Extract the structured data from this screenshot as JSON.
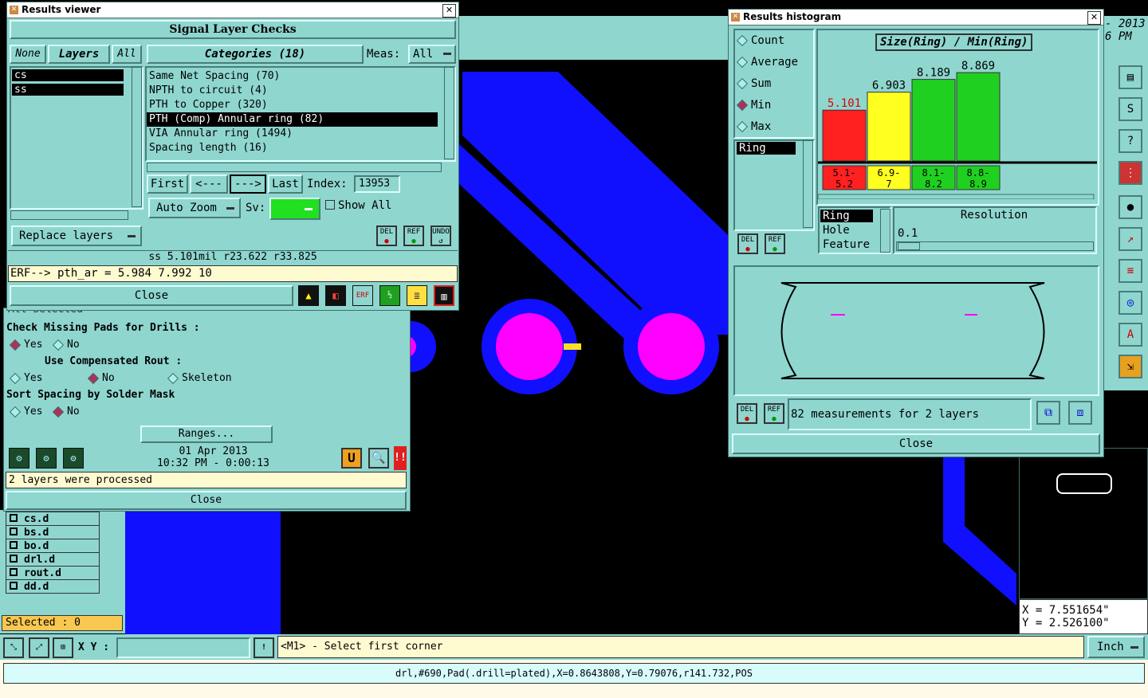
{
  "results_viewer": {
    "title": "Results viewer",
    "header": "Signal Layer Checks",
    "none_btn": "None",
    "layers_btn": "Layers",
    "all_btn": "All",
    "categories_label": "Categories (18)",
    "meas_label": "Meas:",
    "meas_value": "All",
    "layers": [
      "cs",
      "ss"
    ],
    "categories": [
      "Same Net Spacing (70)",
      "NPTH to circuit (4)",
      "PTH to Copper (320)",
      "PTH (Comp) Annular ring (82)",
      "VIA Annular ring (1494)",
      "Spacing length (16)"
    ],
    "nav": {
      "first": "First",
      "prev": "<---",
      "next": "--->",
      "last": "Last",
      "index_label": "Index:",
      "index_value": "13953"
    },
    "auto_zoom": "Auto Zoom",
    "sv_label": "Sv:",
    "show_all": "Show All",
    "replace_layers": "Replace layers",
    "del": "DEL",
    "ref": "REF",
    "undo": "UNDO",
    "status": "ss 5.101mil  r23.622  r33.825",
    "erf_line": "ERF--> pth_ar = 5.984 7.992 10",
    "close": "Close"
  },
  "check_panel": {
    "partial_top": "All        Selected",
    "missing_pads": "Check Missing Pads for Drills :",
    "yes": "Yes",
    "no": "No",
    "comp_rout": "Use Compensated Rout :",
    "skeleton": "Skeleton",
    "sort_spacing": "Sort Spacing by Solder Mask",
    "ranges": "Ranges...",
    "date": "01 Apr 2013",
    "time": "10:32 PM - 0:00:13",
    "processed": "2 layers were processed",
    "close": "Close"
  },
  "layer_list": {
    "items": [
      "cs.d",
      "bs.d",
      "bo.d",
      "drl.d",
      "rout.d",
      "dd.d"
    ],
    "selected": "Selected : 0"
  },
  "histogram": {
    "title": "Results histogram",
    "options": [
      "Count",
      "Average",
      "Sum",
      "Min",
      "Max"
    ],
    "selected_option": "Min",
    "chart_title": "Size(Ring) / Min(Ring)",
    "list_item": "Ring",
    "del": "DEL",
    "ref": "REF",
    "fields": [
      "Ring",
      "Hole",
      "Feature"
    ],
    "resolution_label": "Resolution",
    "resolution_value": "0.1",
    "measurements": "82 measurements for 2 layers",
    "close": "Close"
  },
  "chart_data": {
    "type": "bar",
    "title": "Size(Ring) / Min(Ring)",
    "categories": [
      "5.1-5.2",
      "6.9-7",
      "8.1-8.2",
      "8.8-8.9"
    ],
    "values": [
      5.101,
      6.903,
      8.189,
      8.869
    ],
    "colors": [
      "#ff2020",
      "#ffff20",
      "#20d020",
      "#20d020"
    ],
    "value_label_colors": [
      "#e00000",
      "#000000",
      "#000000",
      "#000000"
    ],
    "ylim": [
      0,
      10
    ]
  },
  "main": {
    "date_partial": "- 2013",
    "time_partial": "6 PM",
    "coord_x": "X = 7.551654\"",
    "coord_y": "Y = 2.526100\"",
    "xy_label": "X Y :",
    "prompt": "<M1> - Select first corner",
    "units": "Inch",
    "status_line": "drl,#690,Pad(.drill=plated),X=0.8643808,Y=0.79076,r141.732,POS"
  },
  "colors": {
    "panel": "#8fd6cf",
    "blue_trace": "#1010ff",
    "pad": "#ff00ff"
  }
}
